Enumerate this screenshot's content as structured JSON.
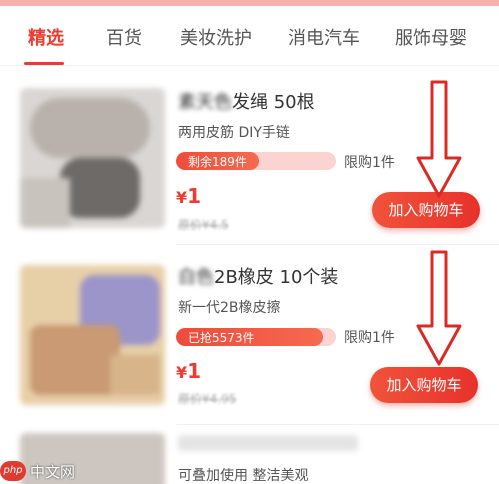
{
  "tabs": [
    {
      "label": "精选",
      "active": true
    },
    {
      "label": "百货"
    },
    {
      "label": "美妆洗护"
    },
    {
      "label": "消电汽车"
    },
    {
      "label": "服饰母婴"
    }
  ],
  "products": [
    {
      "title_blur": "素天色",
      "title": "发绳 50根",
      "subtitle": "两用皮筋 DIY手链",
      "progress_text": "剩余189件",
      "progress_fraction": 0.52,
      "limit": "限购1件",
      "currency": "¥",
      "price": "1",
      "original_price": "原价¥4.5",
      "cart_label": "加入购物车"
    },
    {
      "title_blur": "白色",
      "title": "2B橡皮 10个装",
      "subtitle": "新一代2B橡皮擦",
      "progress_text": "已抢5573件",
      "progress_fraction": 0.92,
      "limit": "限购1件",
      "currency": "¥",
      "price": "1",
      "original_price": "原价¥4.95",
      "cart_label": "加入购物车"
    },
    {
      "subtitle": "可叠加使用 整洁美观"
    }
  ],
  "watermark": {
    "logo": "php",
    "text": "中文网"
  },
  "colors": {
    "accent": "#ee3b2f",
    "progress_bg": "#fbd3d0",
    "arrow": "#d92b24"
  }
}
